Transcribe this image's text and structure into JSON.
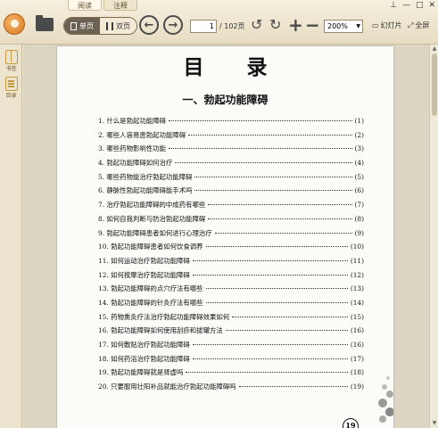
{
  "toolbar": {
    "tabs": [
      "阅读",
      "注释"
    ],
    "view_single": "单页",
    "view_double": "双页",
    "page_current": "1",
    "page_total": "/ 102页",
    "zoom": "200%",
    "slideshow": "幻灯片",
    "fullscreen": "全屏"
  },
  "sidebar": {
    "items": [
      {
        "label": "书签",
        "icon": "bookmark-icon"
      },
      {
        "label": "目录",
        "icon": "toc-icon"
      }
    ]
  },
  "page": {
    "title": "目 录",
    "section": "一、勃起功能障碍",
    "page_number": "19",
    "toc": [
      {
        "text": "1. 什么是勃起功能障碍",
        "page": "(1)"
      },
      {
        "text": "2. 哪些人容易患勃起功能障碍",
        "page": "(2)"
      },
      {
        "text": "3. 哪些药物影响性功能",
        "page": "(3)"
      },
      {
        "text": "4. 勃起功能障碍如何治疗",
        "page": "(4)"
      },
      {
        "text": "5. 哪些药物能治疗勃起功能障碍",
        "page": "(5)"
      },
      {
        "text": "6. 静脉性勃起功能障碍能手术吗",
        "page": "(6)"
      },
      {
        "text": "7. 治疗勃起功能障碍的中成药有哪些",
        "page": "(7)"
      },
      {
        "text": "8. 如何自我判断与防治勃起功能障碍",
        "page": "(8)"
      },
      {
        "text": "9. 勃起功能障碍患者如何进行心理治疗",
        "page": "(9)"
      },
      {
        "text": "10. 勃起功能障碍患者如何饮食调养",
        "page": "(10)"
      },
      {
        "text": "11. 如何运动治疗勃起功能障碍",
        "page": "(11)"
      },
      {
        "text": "12. 如何按摩治疗勃起功能障碍",
        "page": "(12)"
      },
      {
        "text": "13. 勃起功能障碍的点穴疗法有哪些",
        "page": "(13)"
      },
      {
        "text": "14. 勃起功能障碍的针灸疗法有哪些",
        "page": "(14)"
      },
      {
        "text": "15. 药物熏灸疗法治疗勃起功能障碍效果如何",
        "page": "(15)"
      },
      {
        "text": "16. 勃起功能障碍如何使用刮痧和拔罐方法",
        "page": "(16)"
      },
      {
        "text": "17. 如何敷贴治疗勃起功能障碍",
        "page": "(16)"
      },
      {
        "text": "18. 如何药浴治疗勃起功能障碍",
        "page": "(17)"
      },
      {
        "text": "19. 勃起功能障碍就是肾虚吗",
        "page": "(18)"
      },
      {
        "text": "20. 只要服用壮阳补品就能治疗勃起功能障碍吗",
        "page": "(19)"
      }
    ]
  }
}
